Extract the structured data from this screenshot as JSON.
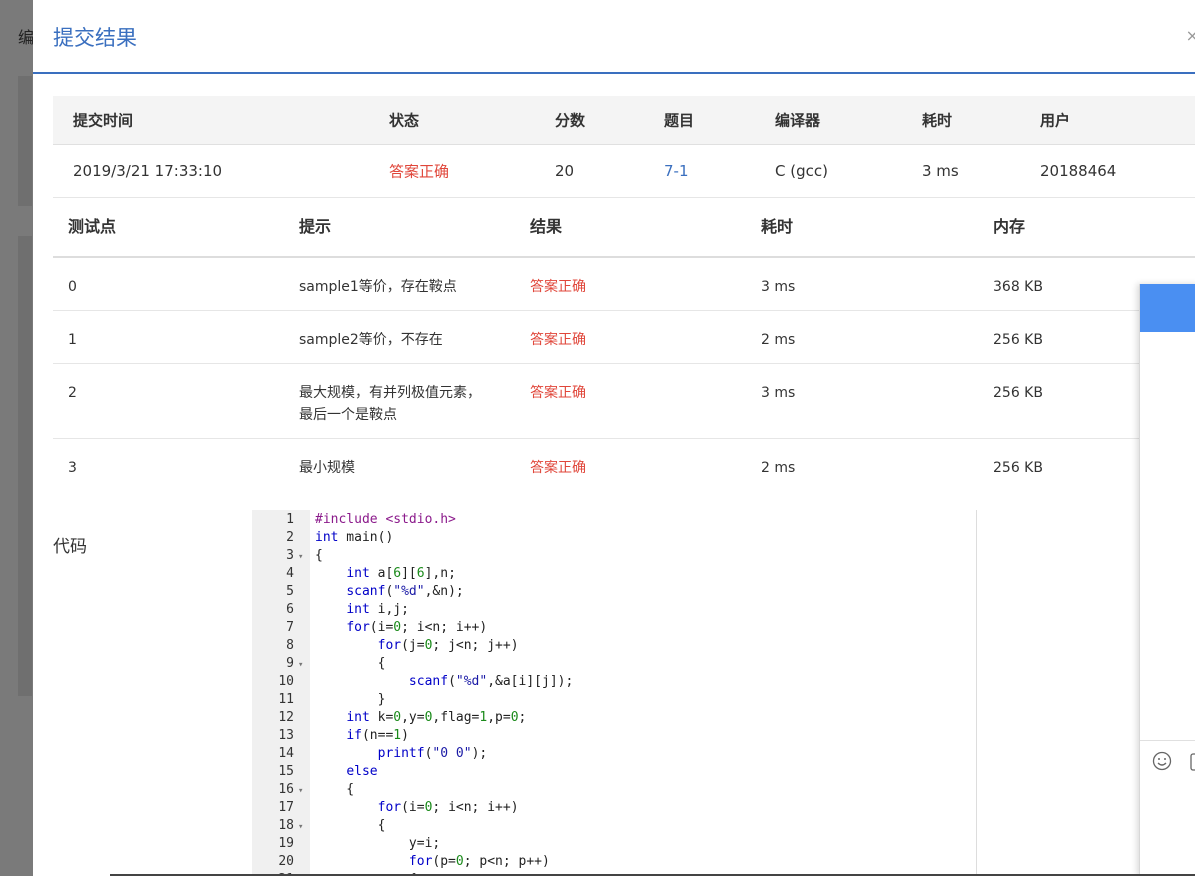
{
  "backdrop": {
    "label": "编"
  },
  "modal": {
    "title": "提交结果",
    "close": "×"
  },
  "summary": {
    "headers": [
      "提交时间",
      "状态",
      "分数",
      "题目",
      "编译器",
      "耗时",
      "用户"
    ],
    "row": {
      "time": "2019/3/21 17:33:10",
      "status": "答案正确",
      "score": "20",
      "problem": "7-1",
      "compiler": "C (gcc)",
      "elapsed": "3 ms",
      "user": "20188464"
    }
  },
  "tests": {
    "headers": [
      "测试点",
      "提示",
      "结果",
      "耗时",
      "内存"
    ],
    "rows": [
      {
        "id": "0",
        "hint": "sample1等价，存在鞍点",
        "hint2": "",
        "result": "答案正确",
        "time": "3 ms",
        "memory": "368 KB"
      },
      {
        "id": "1",
        "hint": "sample2等价，不存在",
        "hint2": "",
        "result": "答案正确",
        "time": "2 ms",
        "memory": "256 KB"
      },
      {
        "id": "2",
        "hint": "最大规模，有并列极值元素，",
        "hint2": "最后一个是鞍点",
        "result": "答案正确",
        "time": "3 ms",
        "memory": "256 KB"
      },
      {
        "id": "3",
        "hint": "最小规模",
        "hint2": "",
        "result": "答案正确",
        "time": "2 ms",
        "memory": "256 KB"
      }
    ]
  },
  "code": {
    "label": "代码",
    "lines": [
      "#include <stdio.h>",
      "int main()",
      "{",
      "    int a[6][6],n;",
      "    scanf(\"%d\",&n);",
      "    int i,j;",
      "    for(i=0; i<n; i++)",
      "        for(j=0; j<n; j++)",
      "        {",
      "            scanf(\"%d\",&a[i][j]);",
      "        }",
      "    int k=0,y=0,flag=1,p=0;",
      "    if(n==1)",
      "        printf(\"0 0\");",
      "    else",
      "    {",
      "        for(i=0; i<n; i++)",
      "        {",
      "            y=i;",
      "            for(p=0; p<n; p++)",
      "            {"
    ],
    "folds": [
      3,
      9,
      16,
      18
    ]
  },
  "chat": {
    "emoji_icon": "smile-icon",
    "image_icon": "image-icon",
    "accent": "#4a8ff2"
  },
  "colors": {
    "accent": "#3a6fbf",
    "success": "#e0463a"
  }
}
